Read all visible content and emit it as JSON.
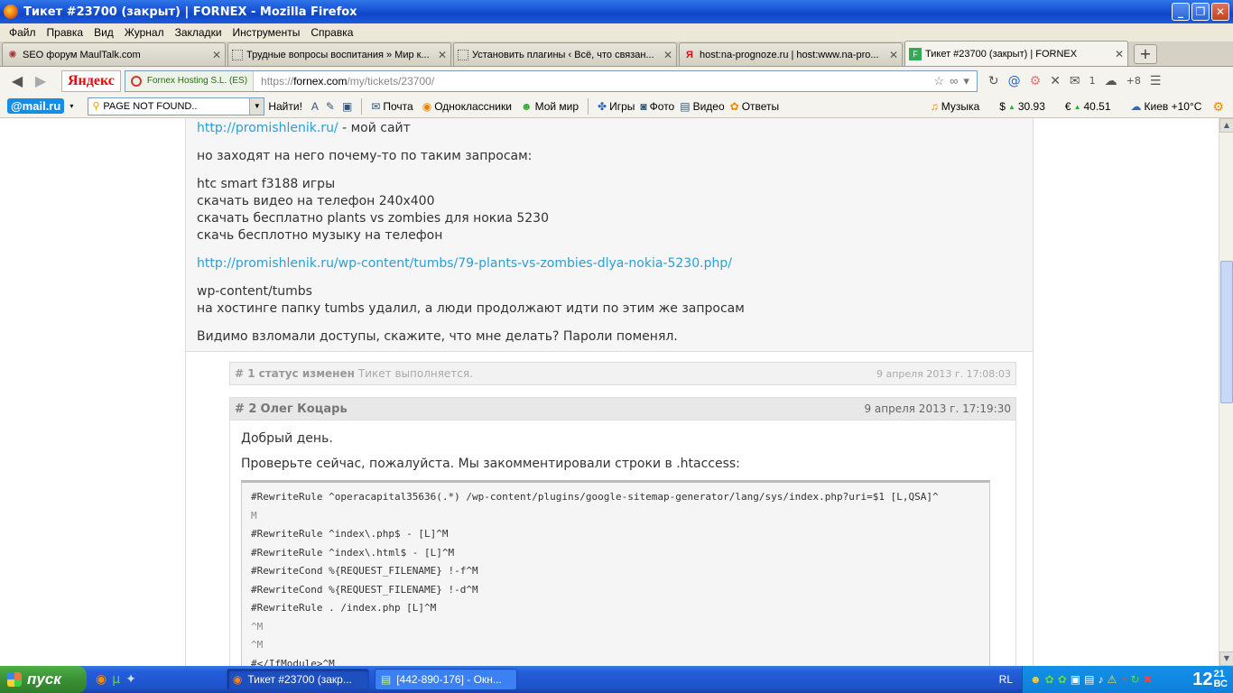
{
  "window": {
    "title": "Тикет #23700 (закрыт) | FORNEX - Mozilla Firefox"
  },
  "menu": [
    "Файл",
    "Правка",
    "Вид",
    "Журнал",
    "Закладки",
    "Инструменты",
    "Справка"
  ],
  "tabs": [
    {
      "label": "SEO форум MaulTalk.com",
      "icon": "maultalk-icon",
      "active": false
    },
    {
      "label": "Трудные вопросы воспитания » Мир к...",
      "icon": "page-icon",
      "active": false
    },
    {
      "label": "Установить плагины ‹ Всё, что связан...",
      "icon": "page-icon",
      "active": false
    },
    {
      "label": "host:na-prognoze.ru | host:www.na-pro...",
      "icon": "yandex-icon",
      "active": false
    },
    {
      "label": "Тикет #23700 (закрыт) | FORNEX",
      "icon": "fornex-icon",
      "active": true
    }
  ],
  "nav": {
    "yandex_logo": "Яндекс",
    "identity": "Fornex Hosting S.L. (ES)",
    "url_prefix": "https://",
    "url_host": "fornex.com",
    "url_path": "/my/tickets/23700/"
  },
  "mailbar": {
    "logo": "@mail.ru",
    "search_value": "PAGE NOT FOUND..",
    "find_label": "Найти!",
    "links": [
      {
        "label": "Почта",
        "icon": "mail-icon"
      },
      {
        "label": "Одноклассники",
        "icon": "odnoklassniki-icon"
      },
      {
        "label": "Мой мир",
        "icon": "moimir-icon"
      },
      {
        "label": "Игры",
        "icon": "games-icon"
      },
      {
        "label": "Фото",
        "icon": "camera-icon"
      },
      {
        "label": "Видео",
        "icon": "video-icon"
      },
      {
        "label": "Ответы",
        "icon": "answers-icon"
      }
    ],
    "music": "Музыка",
    "usd": "30.93",
    "eur": "40.51",
    "weather": "Киев +10°C",
    "mail_count": "1",
    "weather_delta": "+8"
  },
  "message": {
    "link1": "http://promishlenik.ru/",
    "link1_suffix": " - мой сайт",
    "p2": "но заходят на него почему-то по таким запросам:",
    "queries": [
      "htc smart f3188 игры",
      "скачать видео на телефон 240х400",
      "скачать бесплатно plants vs zombies для нокиа 5230",
      "скачь бесплотно музыку на телефон"
    ],
    "link2": "http://promishlenik.ru/wp-content/tumbs/79-plants-vs-zombies-dlya-nokia-5230.php/",
    "p4a": "wp-content/tumbs",
    "p4b": "на хостинге папку tumbs удалил, а люди продолжают идти по этим же запросам",
    "p5": "Видимо взломали доступы, скажите, что мне делать? Пароли поменял."
  },
  "status_event": {
    "num": "# 1",
    "title": "статус изменен",
    "text": "Тикет выполняется.",
    "date": "9 апреля 2013 г. 17:08:03"
  },
  "reply": {
    "num": "# 2",
    "author": "Олег Коцарь",
    "date": "9 апреля 2013 г. 17:19:30",
    "greeting": "Добрый день.",
    "text": "Проверьте сейчас, пожалуйста. Мы закомментировали строки в .htaccess:",
    "code": [
      "#RewriteRule ^operacapital35636(.*) /wp-content/plugins/google-sitemap-generator/lang/sys/index.php?uri=$1 [L,QSA]^",
      "M",
      "#RewriteRule ^index\\.php$ - [L]^M",
      "#RewriteRule ^index\\.html$ - [L]^M",
      "#RewriteCond %{REQUEST_FILENAME} !-f^M",
      "#RewriteCond %{REQUEST_FILENAME} !-d^M",
      "#RewriteRule . /index.php [L]^M",
      "^M",
      "^M",
      "#</IfModule>^M"
    ]
  },
  "taskbar": {
    "start": "пуск",
    "tasks": [
      {
        "label": "Тикет #23700 (закр...",
        "active": true
      },
      {
        "label": "[442-890-176] - Окн...",
        "active": false
      }
    ],
    "lang": "RL",
    "clock_hour": "12",
    "clock_min": "21",
    "clock_day": "ВС"
  }
}
